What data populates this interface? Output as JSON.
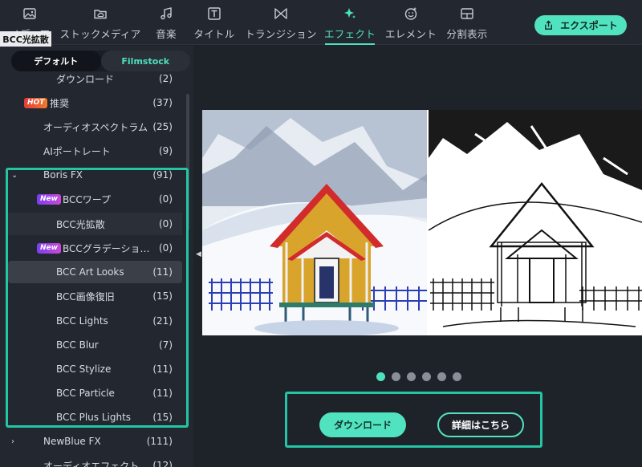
{
  "toolbar": {
    "tabs": [
      {
        "label": "メディア",
        "icon": "image-icon"
      },
      {
        "label": "ストックメディア",
        "icon": "cloud-folder-icon"
      },
      {
        "label": "音楽",
        "icon": "music-note-icon"
      },
      {
        "label": "タイトル",
        "icon": "text-t-icon"
      },
      {
        "label": "トランジション",
        "icon": "transition-bowtie-icon"
      },
      {
        "label": "エフェクト",
        "icon": "sparkle-icon",
        "active": true
      },
      {
        "label": "エレメント",
        "icon": "smiley-icon"
      },
      {
        "label": "分割表示",
        "icon": "split-screen-icon"
      }
    ],
    "export_label": "エクスポート",
    "accent": "#4fe0bd"
  },
  "sidebar": {
    "segment": [
      "デフォルト",
      "Filmstock"
    ],
    "tooltip": "BCC光拡散",
    "items": [
      {
        "name": "ダウンロード",
        "count": "(2)"
      },
      {
        "name": "推奨",
        "count": "(37)",
        "badge": "HOT"
      },
      {
        "name": "オーディオスペクトラム",
        "count": "(25)"
      },
      {
        "name": "AIポートレート",
        "count": "(9)"
      },
      {
        "name": "Boris FX",
        "count": "(91)"
      },
      {
        "name": "BCCワープ",
        "count": "(0)",
        "badge": "New"
      },
      {
        "name": "BCC光拡散",
        "count": "(0)"
      },
      {
        "name": "BCCグラデーション&…",
        "count": "(0)",
        "badge": "New"
      },
      {
        "name": "BCC Art Looks",
        "count": "(11)"
      },
      {
        "name": "BCC画像復旧",
        "count": "(15)"
      },
      {
        "name": "BCC Lights",
        "count": "(21)"
      },
      {
        "name": "BCC Blur",
        "count": "(7)"
      },
      {
        "name": "BCC Stylize",
        "count": "(11)"
      },
      {
        "name": "BCC Particle",
        "count": "(11)"
      },
      {
        "name": "BCC Plus Lights",
        "count": "(15)"
      },
      {
        "name": "NewBlue FX",
        "count": "(111)"
      },
      {
        "name": "オーディオエフェクト",
        "count": "(12)"
      }
    ]
  },
  "preview": {
    "carousel_current": 1,
    "carousel_total": 6,
    "download_label": "ダウンロード",
    "details_label": "詳細はこちら"
  }
}
